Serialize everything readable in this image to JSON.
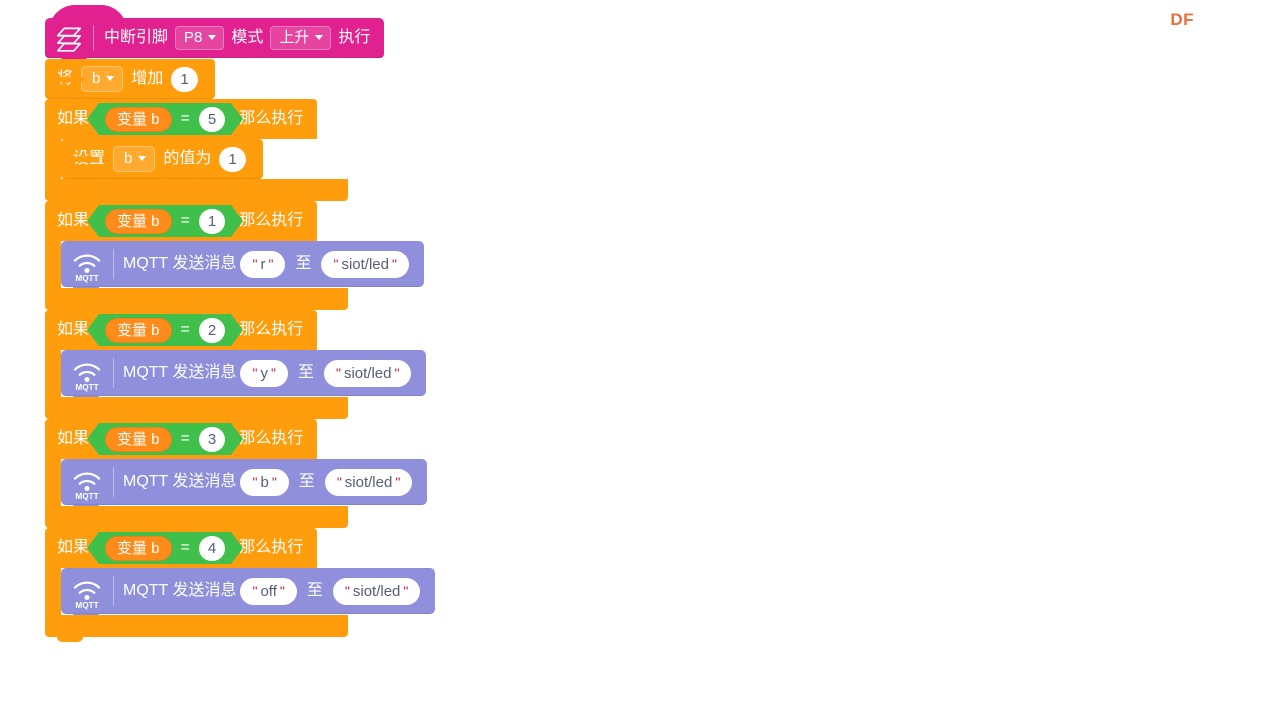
{
  "brand": {
    "logo_text": "DF"
  },
  "colors": {
    "hat_pink": "#e0218f",
    "variable_orange": "#ff9d0d",
    "operator_green": "#40bf4a",
    "mqtt_purple": "#8f8fdc",
    "value_white": "#ffffff",
    "logo_orange": "#e8703a"
  },
  "script": {
    "hat": {
      "icon": "stack-layers-icon",
      "label": "中断引脚",
      "pin_value": "P8",
      "mode_label": "模式",
      "mode_value": "上升",
      "do_label": "执行"
    },
    "change_var": {
      "prefix": "将",
      "variable": "b",
      "action": "增加",
      "amount": "1"
    },
    "if_blocks": [
      {
        "if_label": "如果",
        "then_label": "那么执行",
        "condition": {
          "variable_label": "变量 b",
          "operator": "=",
          "value": "5"
        },
        "body": {
          "kind": "set-variable",
          "prefix": "设置",
          "variable": "b",
          "middle": "的值为",
          "value": "1"
        }
      },
      {
        "if_label": "如果",
        "then_label": "那么执行",
        "condition": {
          "variable_label": "变量 b",
          "operator": "=",
          "value": "1"
        },
        "body": {
          "kind": "mqtt-send",
          "icon": "mqtt-wifi-icon",
          "icon_caption": "MQTT",
          "label": "MQTT 发送消息",
          "message": "r",
          "to_label": "至",
          "topic": "siot/led"
        }
      },
      {
        "if_label": "如果",
        "then_label": "那么执行",
        "condition": {
          "variable_label": "变量 b",
          "operator": "=",
          "value": "2"
        },
        "body": {
          "kind": "mqtt-send",
          "icon": "mqtt-wifi-icon",
          "icon_caption": "MQTT",
          "label": "MQTT 发送消息",
          "message": "y",
          "to_label": "至",
          "topic": "siot/led"
        }
      },
      {
        "if_label": "如果",
        "then_label": "那么执行",
        "condition": {
          "variable_label": "变量 b",
          "operator": "=",
          "value": "3"
        },
        "body": {
          "kind": "mqtt-send",
          "icon": "mqtt-wifi-icon",
          "icon_caption": "MQTT",
          "label": "MQTT 发送消息",
          "message": "b",
          "to_label": "至",
          "topic": "siot/led"
        }
      },
      {
        "if_label": "如果",
        "then_label": "那么执行",
        "condition": {
          "variable_label": "变量 b",
          "operator": "=",
          "value": "4"
        },
        "body": {
          "kind": "mqtt-send",
          "icon": "mqtt-wifi-icon",
          "icon_caption": "MQTT",
          "label": "MQTT 发送消息",
          "message": "off",
          "to_label": "至",
          "topic": "siot/led"
        }
      }
    ]
  }
}
